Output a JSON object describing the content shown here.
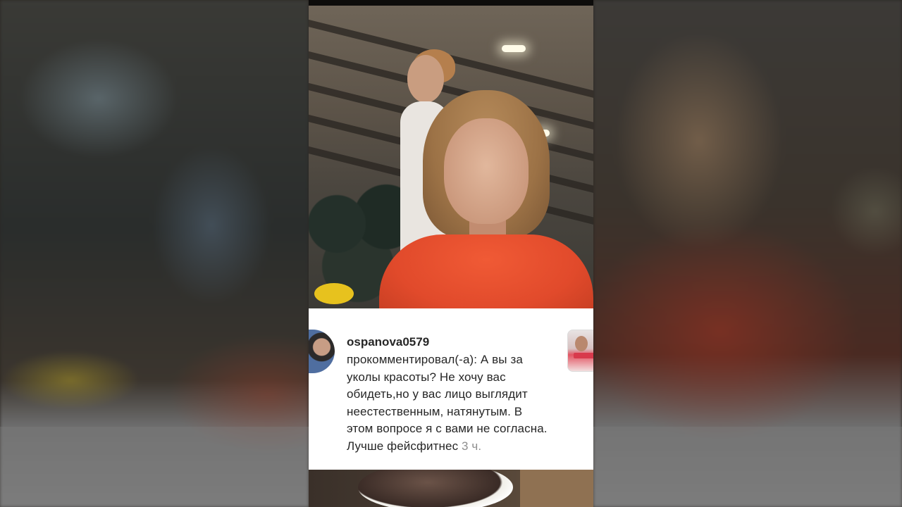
{
  "comment": {
    "username": "ospanova0579",
    "text": "прокомментировал(-а): А вы за уколы красоты? Не хочу вас обидеть,но у вас лицо выглядит неестественным, натянутым. В этом вопросе я с вами не согласна. Лучше фейсфитнес",
    "time": "3 ч."
  },
  "icons": {
    "avatar": "user-avatar",
    "thumbnail": "post-thumbnail"
  },
  "colors": {
    "card_background": "#ffffff",
    "text": "#262626",
    "timestamp": "#8e8e8e",
    "sweater": "#e14a2b"
  }
}
